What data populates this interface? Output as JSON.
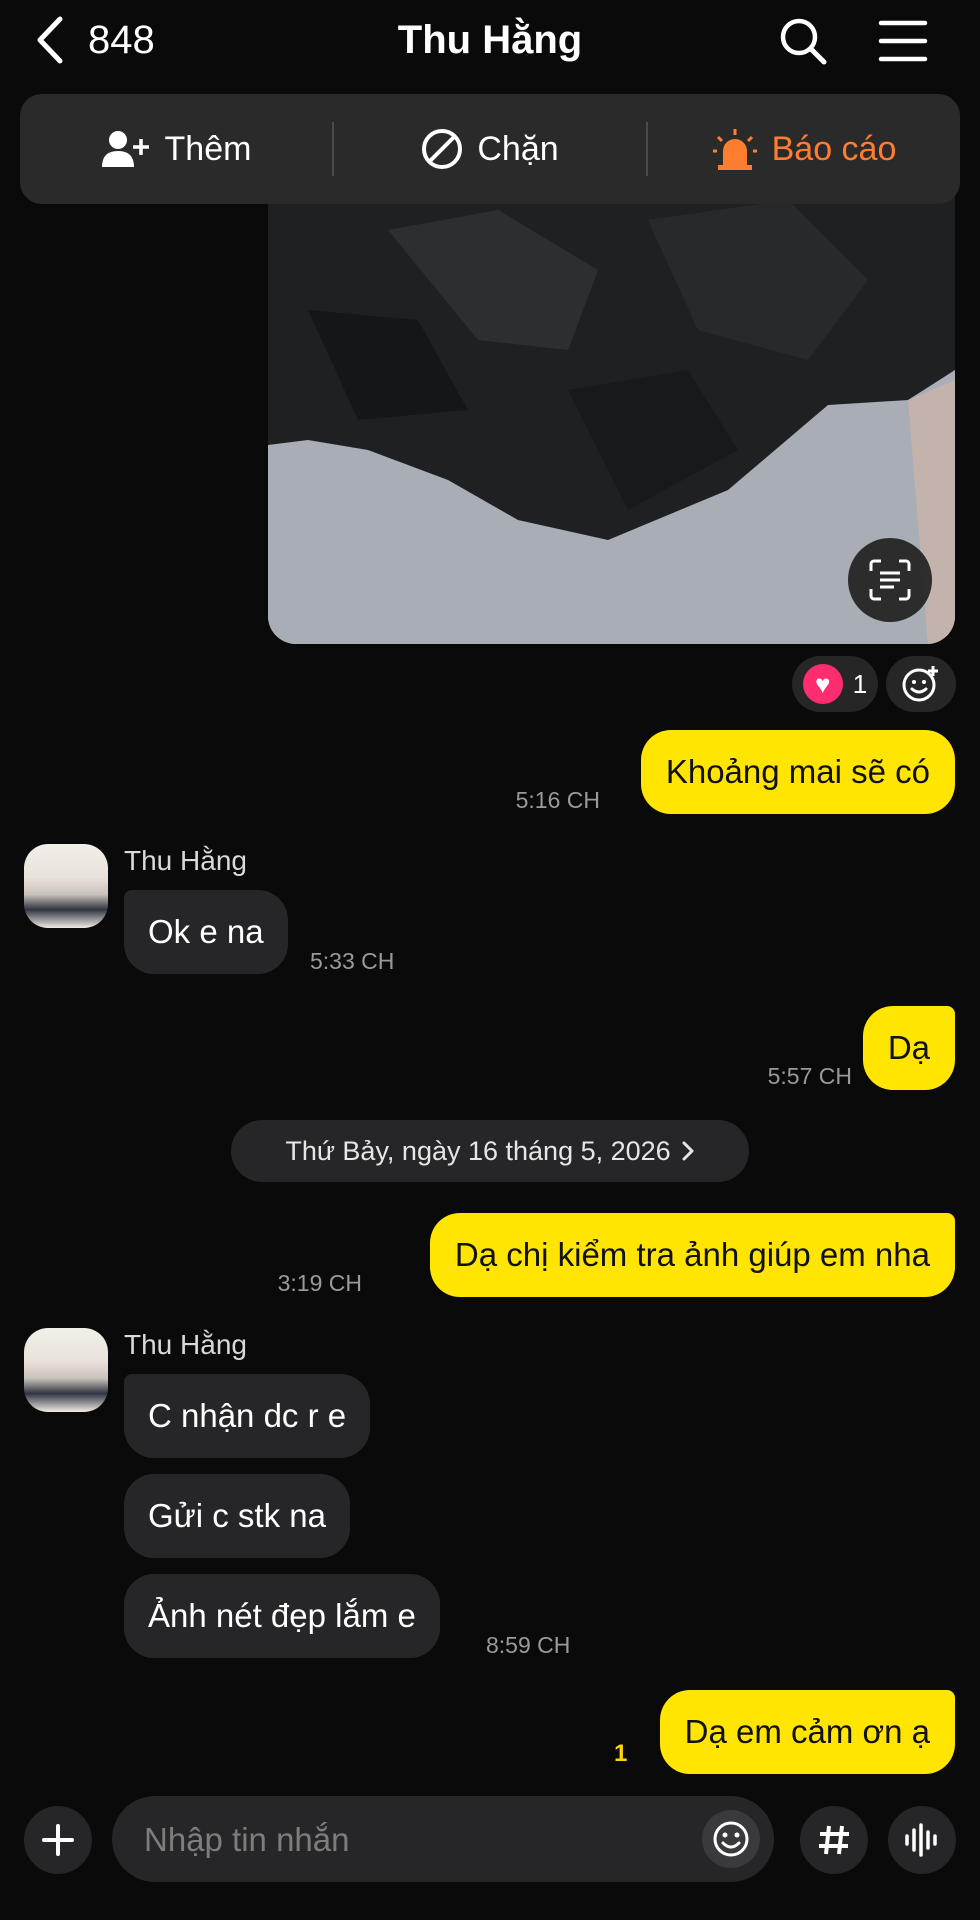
{
  "header": {
    "back_count": "848",
    "title": "Thu Hằng"
  },
  "action_bar": {
    "add_label": "Thêm",
    "block_label": "Chặn",
    "report_label": "Báo cáo",
    "report_color": "#ff7d2e"
  },
  "photo": {
    "reaction_count": "1"
  },
  "messages": [
    {
      "side": "out",
      "text": "Khoảng mai sẽ có",
      "time": "5:16 CH"
    },
    {
      "side": "in",
      "sender": "Thu Hằng",
      "text": "Ok e na",
      "time": "5:33 CH"
    },
    {
      "side": "out",
      "text": "Dạ",
      "time": "5:57 CH"
    },
    {
      "side": "date",
      "text": "Thứ Bảy, ngày 16 tháng 5, 2026"
    },
    {
      "side": "out",
      "text": "Dạ chị kiểm tra ảnh giúp em nha",
      "time": "3:19 CH"
    },
    {
      "side": "in",
      "sender": "Thu Hằng",
      "text": "C nhận dc r e"
    },
    {
      "side": "in",
      "text": "Gửi c stk na"
    },
    {
      "side": "in",
      "text": "Ảnh nét đẹp lắm e",
      "time": "8:59 CH"
    },
    {
      "side": "out",
      "text": "Dạ em cảm ơn ạ",
      "read_count": "1"
    }
  ],
  "composer": {
    "placeholder": "Nhập tin nhắn"
  },
  "colors": {
    "outgoing_bubble": "#ffe500",
    "incoming_bubble": "#262628",
    "background": "#0a0a0a",
    "heart": "#ff2d6f"
  }
}
